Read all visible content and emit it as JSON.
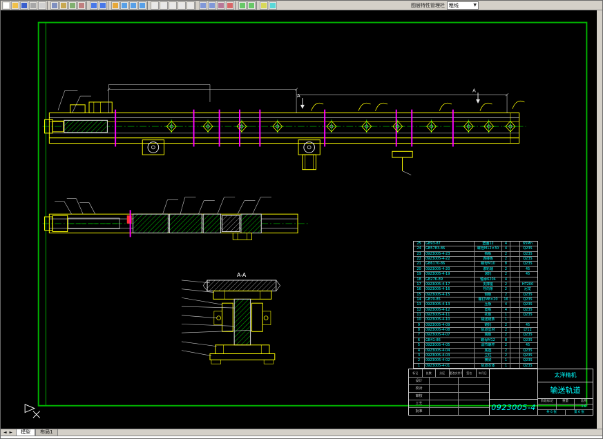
{
  "toolbar": {
    "icons": [
      {
        "name": "new",
        "color": "#ffffff"
      },
      {
        "name": "open",
        "color": "#f0c048"
      },
      {
        "name": "save",
        "color": "#3a5fcd"
      },
      {
        "name": "plot",
        "color": "#a8a8a8"
      },
      {
        "name": "plot-preview",
        "color": "#d0d0d0"
      },
      {
        "sep": true
      },
      {
        "name": "cut",
        "color": "#8090c0"
      },
      {
        "name": "copy",
        "color": "#c8a850"
      },
      {
        "name": "paste",
        "color": "#80b070"
      },
      {
        "name": "match-properties",
        "color": "#c08080"
      },
      {
        "sep": true
      },
      {
        "name": "undo",
        "color": "#4878e8"
      },
      {
        "name": "redo",
        "color": "#4878e8"
      },
      {
        "sep": true
      },
      {
        "name": "pan",
        "color": "#e8a838"
      },
      {
        "name": "zoom-realtime",
        "color": "#58a0e8"
      },
      {
        "name": "zoom-window",
        "color": "#58a0e8"
      },
      {
        "name": "zoom-previous",
        "color": "#58a0e8"
      },
      {
        "sep": true
      },
      {
        "name": "line",
        "color": "#e8e8e8"
      },
      {
        "name": "polyline",
        "color": "#e8e8e8"
      },
      {
        "name": "circle",
        "color": "#e8e8e8"
      },
      {
        "name": "arc",
        "color": "#e8e8e8"
      },
      {
        "name": "text",
        "color": "#e8e8e8"
      },
      {
        "sep": true
      },
      {
        "name": "move",
        "color": "#8098d8"
      },
      {
        "name": "rotate",
        "color": "#8098d8"
      },
      {
        "name": "trim",
        "color": "#b87898"
      },
      {
        "name": "erase",
        "color": "#d86868"
      },
      {
        "sep": true
      },
      {
        "name": "distance",
        "color": "#68c868"
      },
      {
        "name": "area",
        "color": "#68c868"
      },
      {
        "sep": true
      },
      {
        "name": "layers",
        "color": "#d8d858"
      },
      {
        "name": "properties",
        "color": "#58d8d8"
      }
    ],
    "right_label": "图层特性管理栏",
    "layer_combo": "粗线"
  },
  "drawing": {
    "section_label": "A-A",
    "section_mark": "A",
    "section_mark2": "A"
  },
  "bom": {
    "rows": [
      {
        "no": "25",
        "code": "GB93-87",
        "name": "垫圈12",
        "qty": "4",
        "unit": "",
        "mat": "65Mn"
      },
      {
        "no": "24",
        "code": "GB5783-86",
        "name": "螺栓M12×30",
        "qty": "4",
        "unit": "",
        "mat": "Q235"
      },
      {
        "no": "23",
        "code": "0923005-4-23",
        "name": "挡板",
        "qty": "2",
        "unit": "",
        "mat": "Q235"
      },
      {
        "no": "22",
        "code": "0923005-4-22",
        "name": "连接板",
        "qty": "2",
        "unit": "",
        "mat": "Q235"
      },
      {
        "no": "21",
        "code": "GB6170-86",
        "name": "螺母M10",
        "qty": "8",
        "unit": "",
        "mat": "Q235"
      },
      {
        "no": "20",
        "code": "0923005-4-20",
        "name": "滚轮轴",
        "qty": "2",
        "unit": "",
        "mat": "45"
      },
      {
        "no": "19",
        "code": "0923005-4-19",
        "name": "滚轮",
        "qty": "2",
        "unit": "",
        "mat": "45"
      },
      {
        "no": "18",
        "code": "GB276-89",
        "name": "轴承6204",
        "qty": "4",
        "unit": "",
        "mat": ""
      },
      {
        "no": "17",
        "code": "0923005-4-17",
        "name": "支撑座",
        "qty": "2",
        "unit": "",
        "mat": "HT200"
      },
      {
        "no": "16",
        "code": "0923005-4-16",
        "name": "导向条",
        "qty": "2",
        "unit": "",
        "mat": "尼龙"
      },
      {
        "no": "15",
        "code": "0923005-4-15",
        "name": "侧板",
        "qty": "2",
        "unit": "",
        "mat": "Q235"
      },
      {
        "no": "14",
        "code": "GB70-85",
        "name": "螺钉M8×20",
        "qty": "16",
        "unit": "",
        "mat": "Q235"
      },
      {
        "no": "13",
        "code": "0923005-4-13",
        "name": "压板",
        "qty": "4",
        "unit": "",
        "mat": "Q235"
      },
      {
        "no": "12",
        "code": "0923005-4-12",
        "name": "垫板",
        "qty": "4",
        "unit": "",
        "mat": "Q235"
      },
      {
        "no": "11",
        "code": "0923005-4-11",
        "name": "托板",
        "qty": "1",
        "unit": "",
        "mat": "Q235"
      },
      {
        "no": "10",
        "code": "0923005-4-10",
        "name": "输送链条",
        "qty": "1",
        "unit": "",
        "mat": ""
      },
      {
        "no": "9",
        "code": "0923005-4-09",
        "name": "链轮",
        "qty": "2",
        "unit": "",
        "mat": "45"
      },
      {
        "no": "8",
        "code": "0923005-4-08",
        "name": "轨道型材",
        "qty": "2",
        "unit": "",
        "mat": "LY12"
      },
      {
        "no": "7",
        "code": "0923005-4-07",
        "name": "端板",
        "qty": "2",
        "unit": "",
        "mat": "Q235"
      },
      {
        "no": "6",
        "code": "GB41-86",
        "name": "螺母M12",
        "qty": "8",
        "unit": "",
        "mat": "Q235"
      },
      {
        "no": "5",
        "code": "0923005-4-05",
        "name": "调节螺杆",
        "qty": "2",
        "unit": "",
        "mat": "45"
      },
      {
        "no": "4",
        "code": "0923005-4-04",
        "name": "底座",
        "qty": "2",
        "unit": "",
        "mat": "Q235"
      },
      {
        "no": "3",
        "code": "0923005-4-03",
        "name": "立柱",
        "qty": "2",
        "unit": "",
        "mat": "Q235"
      },
      {
        "no": "2",
        "code": "0923005-4-02",
        "name": "横梁",
        "qty": "1",
        "unit": "",
        "mat": "Q235"
      },
      {
        "no": "1",
        "code": "0923005-4-01",
        "name": "轨道本体",
        "qty": "1",
        "unit": "",
        "mat": "Q235"
      }
    ]
  },
  "title_block": {
    "company": "太洋精机",
    "part_name": "输送轨道",
    "drawing_no": "0923005-4",
    "scale_value": "1:8",
    "sheet_total": "共 6 张",
    "sheet_no": "第 6 张",
    "labels": {
      "mark": "标记",
      "count": "处数",
      "zone": "分区",
      "file": "更改文件号",
      "sign": "签名",
      "date": "年月日",
      "stage": "阶段标记",
      "weight": "重量",
      "scale": "比例"
    },
    "sign_rows": [
      "设计",
      "校对",
      "审核",
      "工艺",
      "批准"
    ]
  },
  "tabs": {
    "arrows": "◄ ►",
    "items": [
      "模型",
      "布局1"
    ]
  },
  "colors": {
    "frame": "#00b400",
    "geometry": "#ffff00",
    "section_line": "#ff00ff",
    "annotation": "#00ffff"
  }
}
